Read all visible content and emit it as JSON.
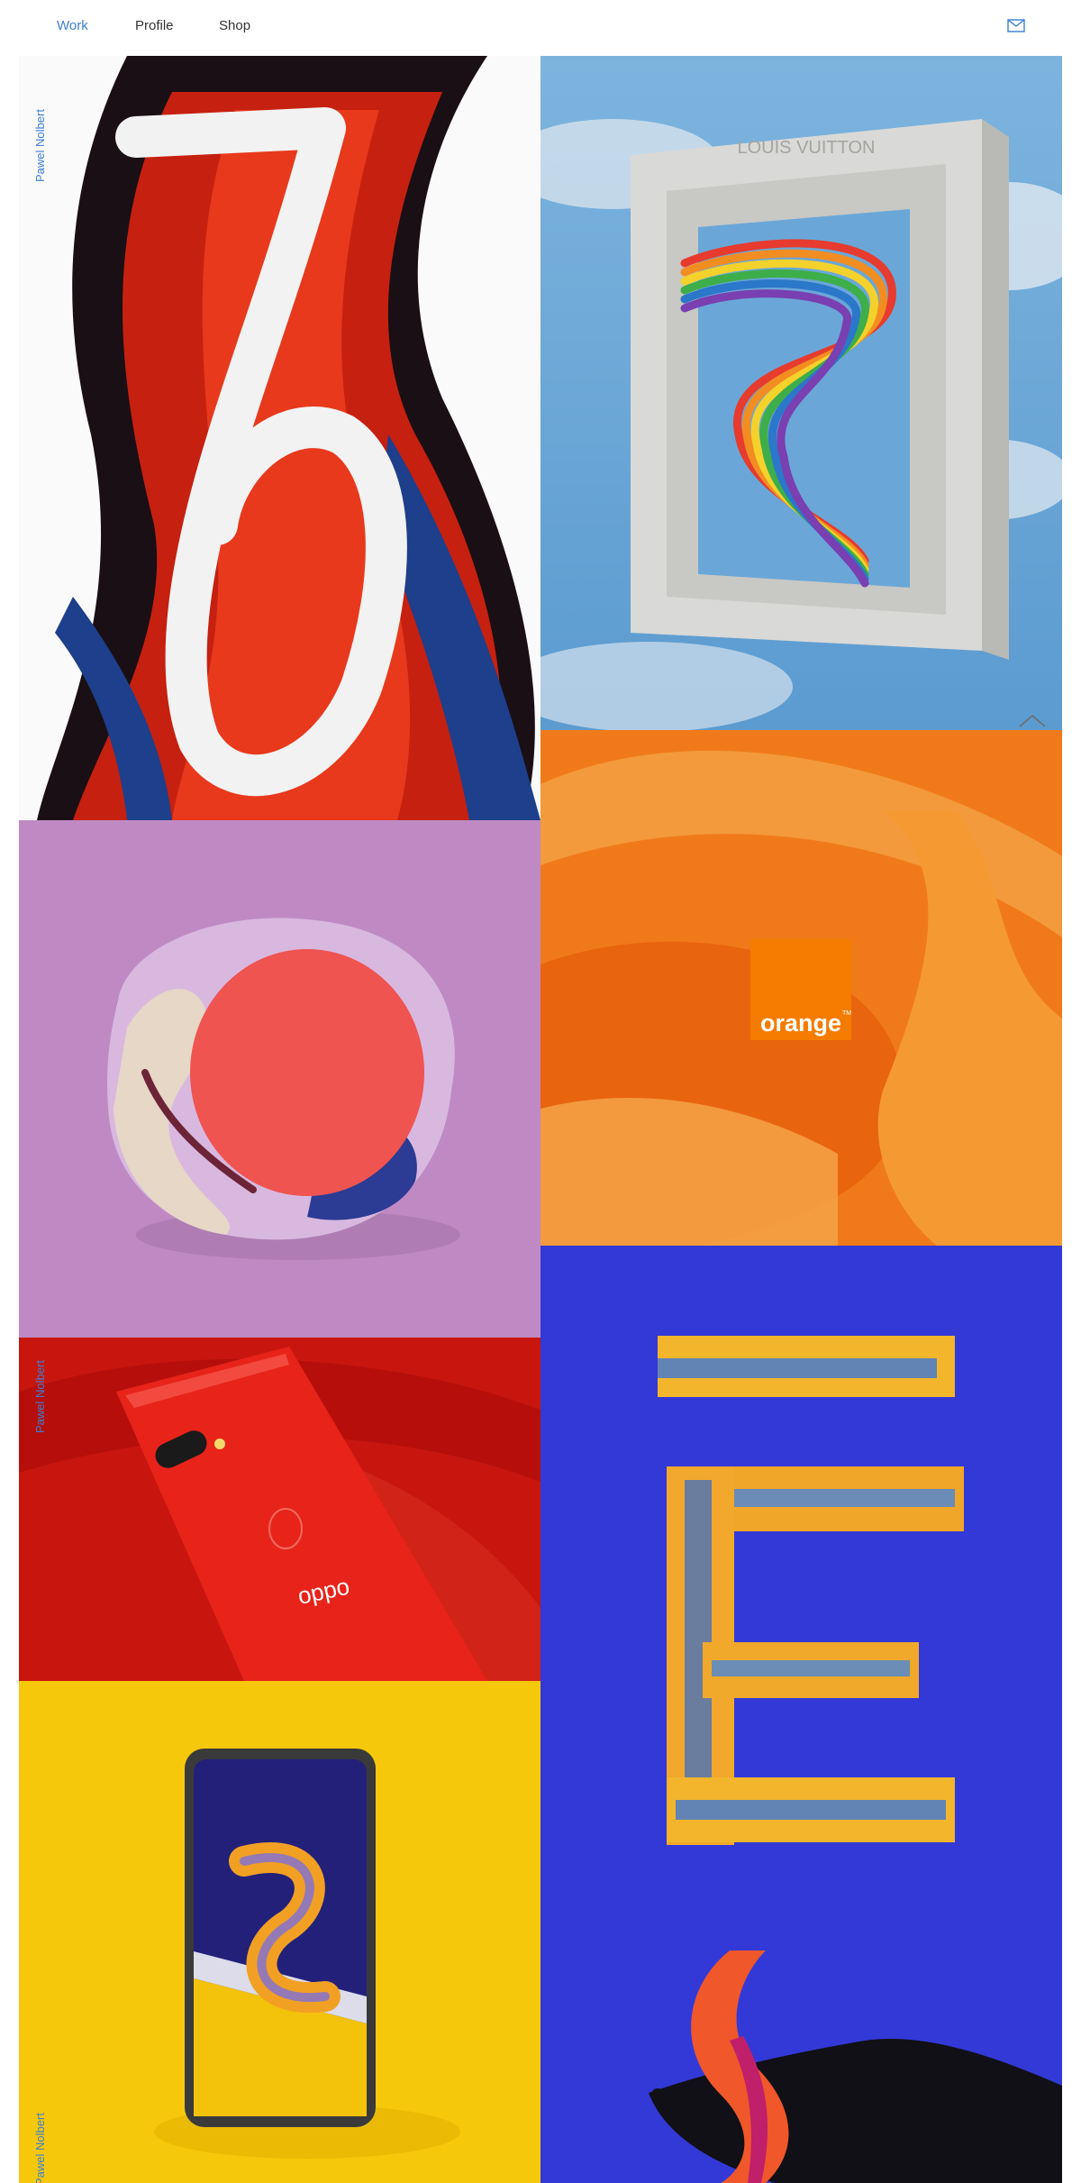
{
  "nav": {
    "items": [
      {
        "label": "Work",
        "active": true
      },
      {
        "label": "Profile",
        "active": false
      },
      {
        "label": "Shop",
        "active": false
      }
    ],
    "contact_icon": "mail-icon"
  },
  "artist_name": "Pawel Nolbert",
  "tiles": {
    "number_seven": {
      "label": "Pawel Nolbert"
    },
    "rainbow_frame": {
      "engraving": "LOUIS VUITTON"
    },
    "lilac_blob": {},
    "orange_brand": {
      "logo_text": "orange",
      "logo_mark": "TM"
    },
    "oppo_phone": {
      "label": "Pawel Nolbert",
      "brand_text": "oppo"
    },
    "letter_e": {},
    "yellow_phone": {
      "label": "Pawel Nolbert"
    },
    "hand_paint": {}
  },
  "colors": {
    "accent": "#3b7fd4",
    "lilac": "#bf8ac4",
    "orange": "#f07a1a",
    "red": "#c8160f",
    "blue": "#3239d6",
    "yellow": "#f6c80b"
  },
  "scroll_top_icon": "chevron-up-icon"
}
